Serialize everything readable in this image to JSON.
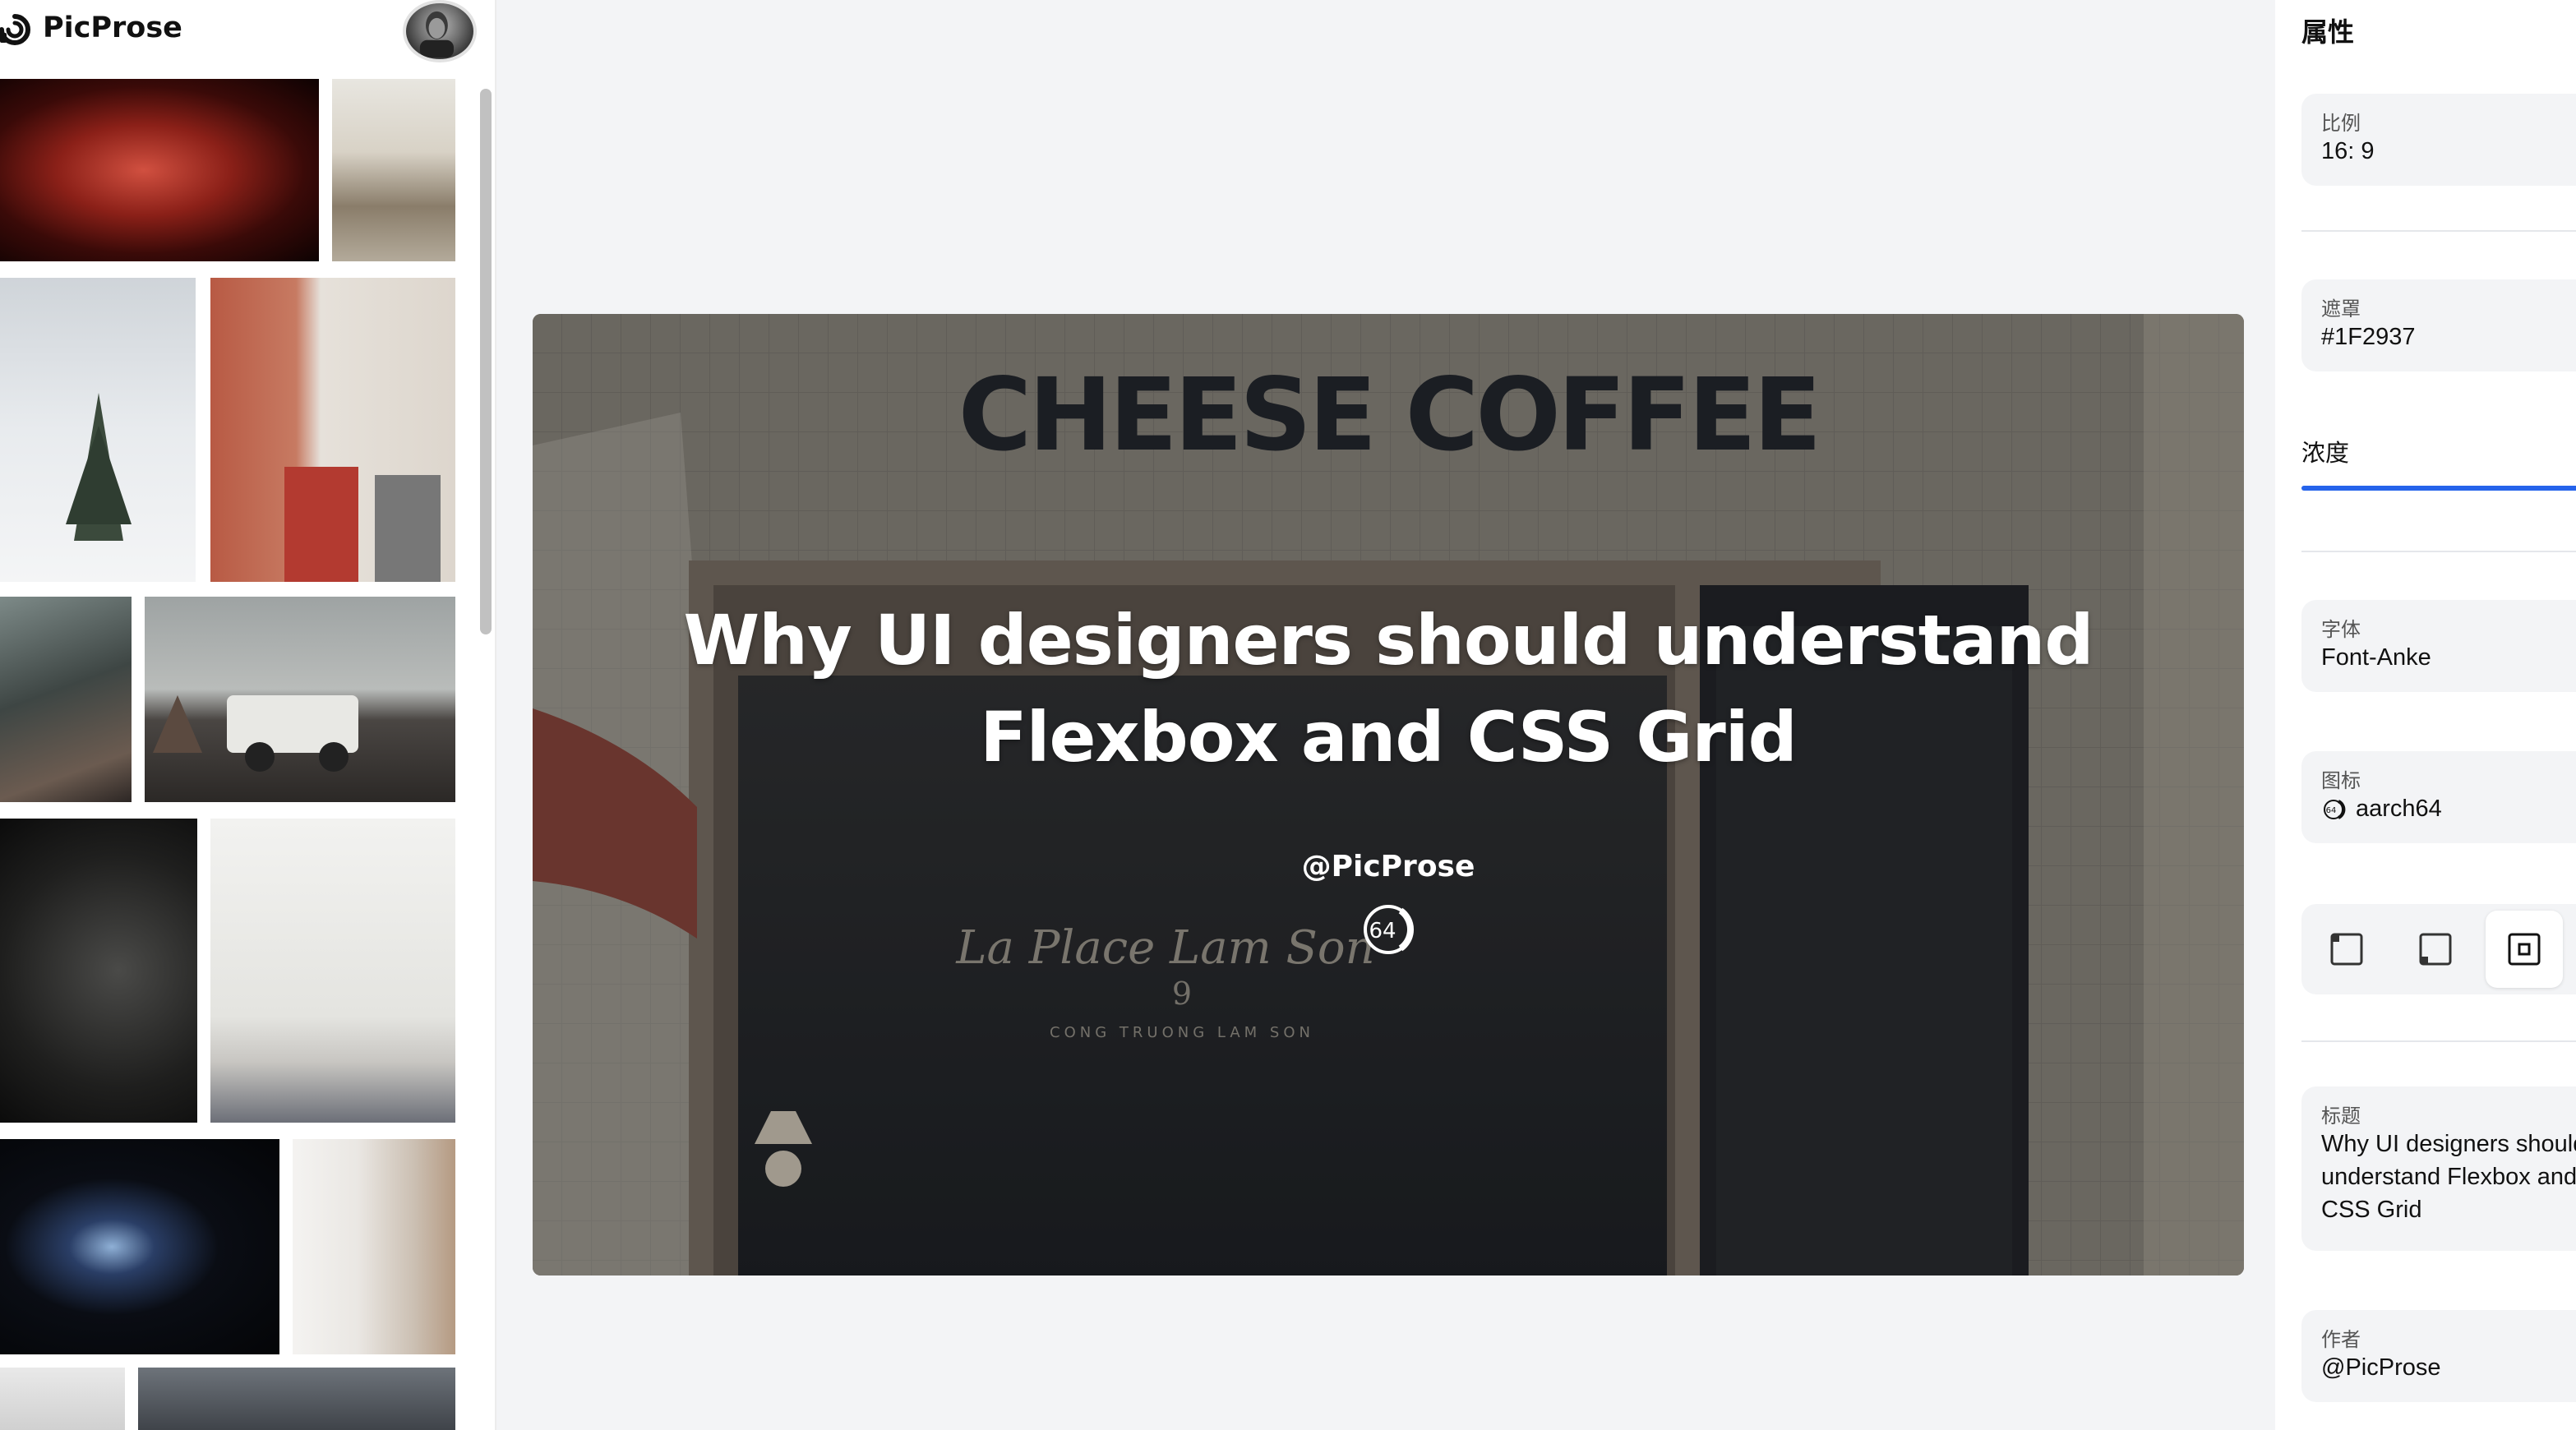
{
  "brand": {
    "name": "PicProse",
    "logo_icon": "picprose-logo-icon"
  },
  "sidebar": {
    "avatar": "user-avatar",
    "gallery": [
      {
        "subject": "red-fabric-abstract",
        "color": "#7a1f1a"
      },
      {
        "subject": "greenhouse-interior",
        "color": "#c9c4b8"
      },
      {
        "subject": "snowy-pine-tree",
        "color": "#e3e6ea"
      },
      {
        "subject": "red-building-street",
        "color": "#c9b9ae"
      },
      {
        "subject": "mountain-landscape",
        "color": "#58605c"
      },
      {
        "subject": "land-rover-jeep",
        "color": "#4a4746"
      },
      {
        "subject": "dark-leaves-water",
        "color": "#2b2b2b"
      },
      {
        "subject": "white-garage-door",
        "color": "#e6e6e4"
      },
      {
        "subject": "blue-jellyfish",
        "color": "#0a0d14"
      },
      {
        "subject": "white-building-balcony",
        "color": "#e9e6e2"
      },
      {
        "subject": "person-portrait",
        "color": "#dcdcdc"
      },
      {
        "subject": "umbrella-street",
        "color": "#5a5f66"
      }
    ]
  },
  "preview": {
    "title": "Why UI designers should understand Flexbox and CSS Grid",
    "author": "@PicProse",
    "author_icon": "aarch64-icon",
    "background": "cheese-coffee-storefront",
    "overlay_color": "#1F2937"
  },
  "props": {
    "panel_title": "属性",
    "ratio": {
      "label": "比例",
      "value": "16: 9"
    },
    "mask": {
      "label": "遮罩",
      "value": "#1F2937"
    },
    "opacity": {
      "label": "浓度",
      "value": 0.99
    },
    "font": {
      "label": "字体",
      "value": "Font-Anke"
    },
    "icon": {
      "label": "图标",
      "value": "aarch64",
      "icon": "aarch64-icon"
    },
    "icon_position": {
      "options": [
        "top-left-icon",
        "bottom-left-icon",
        "center-icon"
      ],
      "selected": "center-icon"
    },
    "title": {
      "label": "标题",
      "value": "Why UI designers should understand Flexbox and CSS Grid"
    },
    "author": {
      "label": "作者",
      "value": "@PicProse"
    }
  },
  "colors": {
    "accent": "#2563EB",
    "panel_bg": "#F3F4F6"
  }
}
